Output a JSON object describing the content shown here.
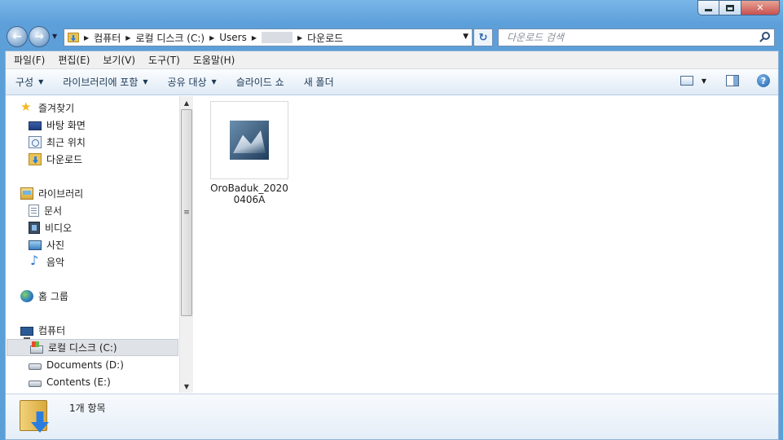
{
  "window": {
    "controls": {
      "minimize": "minimize",
      "maximize": "maximize",
      "close": "✕"
    }
  },
  "address": {
    "crumbs": [
      "컴퓨터",
      "로컬 디스크 (C:)",
      "Users",
      "",
      "다운로드"
    ]
  },
  "search": {
    "placeholder": "다운로드 검색"
  },
  "menu": [
    "파일(F)",
    "편집(E)",
    "보기(V)",
    "도구(T)",
    "도움말(H)"
  ],
  "toolbar": {
    "organize": "구성",
    "include_in_library": "라이브러리에 포함",
    "share_with": "공유 대상",
    "slideshow": "슬라이드 쇼",
    "new_folder": "새 폴더"
  },
  "nav": {
    "favorites": {
      "label": "즐겨찾기",
      "items": [
        "바탕 화면",
        "최근 위치",
        "다운로드"
      ]
    },
    "libraries": {
      "label": "라이브러리",
      "items": [
        "문서",
        "비디오",
        "사진",
        "음악"
      ]
    },
    "homegroup": {
      "label": "홈 그룹"
    },
    "computer": {
      "label": "컴퓨터",
      "items": [
        "로컬 디스크 (C:)",
        "Documents (D:)",
        "Contents (E:)"
      ]
    }
  },
  "files": [
    {
      "name": "OroBaduk_20200406A",
      "icon": "app-icon"
    }
  ],
  "details": {
    "count_text": "1개 항목"
  }
}
